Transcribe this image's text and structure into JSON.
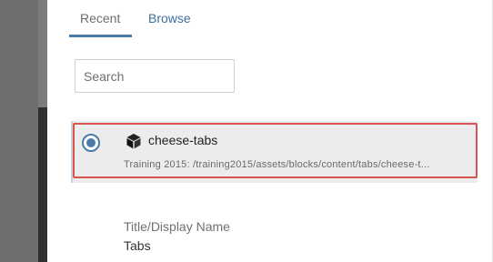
{
  "tabs": [
    {
      "label": "Recent",
      "active": true
    },
    {
      "label": "Browse",
      "active": false
    }
  ],
  "search": {
    "placeholder": "Search",
    "value": ""
  },
  "result": {
    "selected": true,
    "icon": "block-cube-icon",
    "title": "cheese-tabs",
    "path": "Training 2015: /training2015/assets/blocks/content/tabs/cheese-t..."
  },
  "details": {
    "title_label": "Title/Display Name",
    "title_value": "Tabs"
  },
  "colors": {
    "accent": "#4b7da8",
    "highlight_border": "#d9534f",
    "selected_row_bg": "#ececec"
  }
}
